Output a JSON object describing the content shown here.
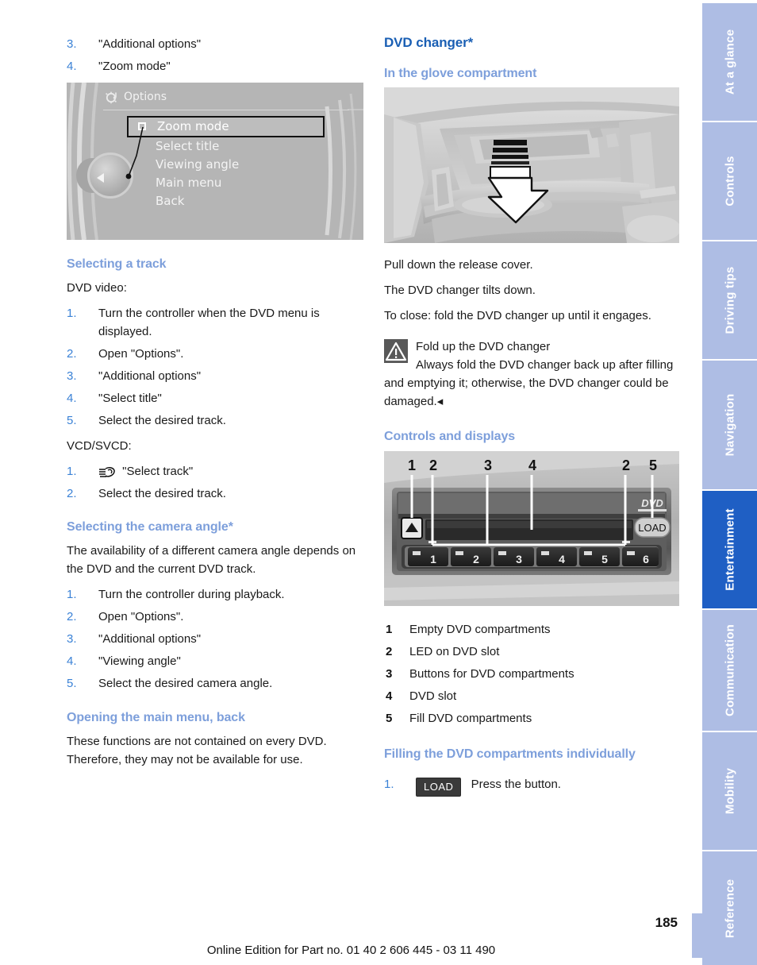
{
  "left_column": {
    "continued_steps": [
      {
        "num": "3.",
        "text": "\"Additional options\""
      },
      {
        "num": "4.",
        "text": "\"Zoom mode\""
      }
    ],
    "idrive_figure": {
      "screen_title": "Options",
      "icon": "options-gear-note-icon",
      "menu_items": [
        {
          "label": "Zoom mode",
          "selected": true,
          "checkbox": true
        },
        {
          "label": "Select title",
          "selected": false,
          "checkbox": false
        },
        {
          "label": "Viewing angle",
          "selected": false,
          "checkbox": false
        },
        {
          "label": "Main menu",
          "selected": false,
          "checkbox": false
        },
        {
          "label": "Back",
          "selected": false,
          "checkbox": false
        }
      ]
    },
    "section_track": {
      "heading": "Selecting a track",
      "intro": "DVD video:",
      "steps": [
        {
          "num": "1.",
          "text": "Turn the controller when the DVD menu is displayed."
        },
        {
          "num": "2.",
          "text": "Open \"Options\"."
        },
        {
          "num": "3.",
          "text": "\"Additional options\""
        },
        {
          "num": "4.",
          "text": "\"Select title\""
        },
        {
          "num": "5.",
          "text": "Select the desired track."
        }
      ],
      "subintro": "VCD/SVCD:",
      "steps2": [
        {
          "num": "1.",
          "icon": "disc-hand-icon",
          "text": "\"Select track\""
        },
        {
          "num": "2.",
          "text": "Select the desired track."
        }
      ]
    },
    "section_camera": {
      "heading": "Selecting the camera angle*",
      "body": "The availability of a different camera angle depends on the DVD and the current DVD track.",
      "steps": [
        {
          "num": "1.",
          "text": "Turn the controller during playback."
        },
        {
          "num": "2.",
          "text": "Open \"Options\"."
        },
        {
          "num": "3.",
          "text": "\"Additional options\""
        },
        {
          "num": "4.",
          "text": "\"Viewing angle\""
        },
        {
          "num": "5.",
          "text": "Select the desired camera angle."
        }
      ]
    },
    "section_mainmenu": {
      "heading": "Opening the main menu, back",
      "body": "These functions are not contained on every DVD. Therefore, they may not be available for use."
    }
  },
  "right_column": {
    "title": "DVD changer*",
    "section_glove": {
      "heading": "In the glove compartment",
      "figure_alt": "glove-compartment-release-cover",
      "lines": [
        "Pull down the release cover.",
        "The DVD changer tilts down.",
        "To close: fold the DVD changer up until it engages."
      ]
    },
    "warning": {
      "icon": "warning-triangle-icon",
      "title": "Fold up the DVD changer",
      "body": "Always fold the DVD changer back up after filling and emptying it; otherwise, the DVD changer could be damaged.◂"
    },
    "section_controls": {
      "heading": "Controls and displays",
      "figure": {
        "callout_labels_top": [
          "1",
          "2",
          "3",
          "4",
          "2",
          "5"
        ],
        "eject_icon": "eject-triangle-icon",
        "load_label": "LOAD",
        "dvd_logo": "DVD",
        "compartment_buttons": [
          "1",
          "2",
          "3",
          "4",
          "5",
          "6"
        ]
      },
      "legend": [
        {
          "key": "1",
          "text": "Empty DVD compartments"
        },
        {
          "key": "2",
          "text": "LED on DVD slot"
        },
        {
          "key": "3",
          "text": "Buttons for DVD compartments"
        },
        {
          "key": "4",
          "text": "DVD slot"
        },
        {
          "key": "5",
          "text": "Fill DVD compartments"
        }
      ]
    },
    "section_filling": {
      "heading": "Filling the DVD compartments individually",
      "steps": [
        {
          "num": "1.",
          "chip": "LOAD",
          "text": "Press the button."
        }
      ]
    }
  },
  "tabs": [
    {
      "label": "At a glance",
      "active": false
    },
    {
      "label": "Controls",
      "active": false
    },
    {
      "label": "Driving tips",
      "active": false
    },
    {
      "label": "Navigation",
      "active": false
    },
    {
      "label": "Entertainment",
      "active": true
    },
    {
      "label": "Communication",
      "active": false
    },
    {
      "label": "Mobility",
      "active": false
    },
    {
      "label": "Reference",
      "active": false
    }
  ],
  "footer": {
    "page_number": "185",
    "online_edition": "Online Edition for Part no. 01 40 2 606 445 - 03 11 490"
  },
  "colors": {
    "heading_main": "#1a5fb4",
    "heading_sub": "#7d9fdb",
    "step_number": "#3b82d6",
    "tab_inactive": "#aebde4",
    "tab_active": "#1f5fc4"
  }
}
